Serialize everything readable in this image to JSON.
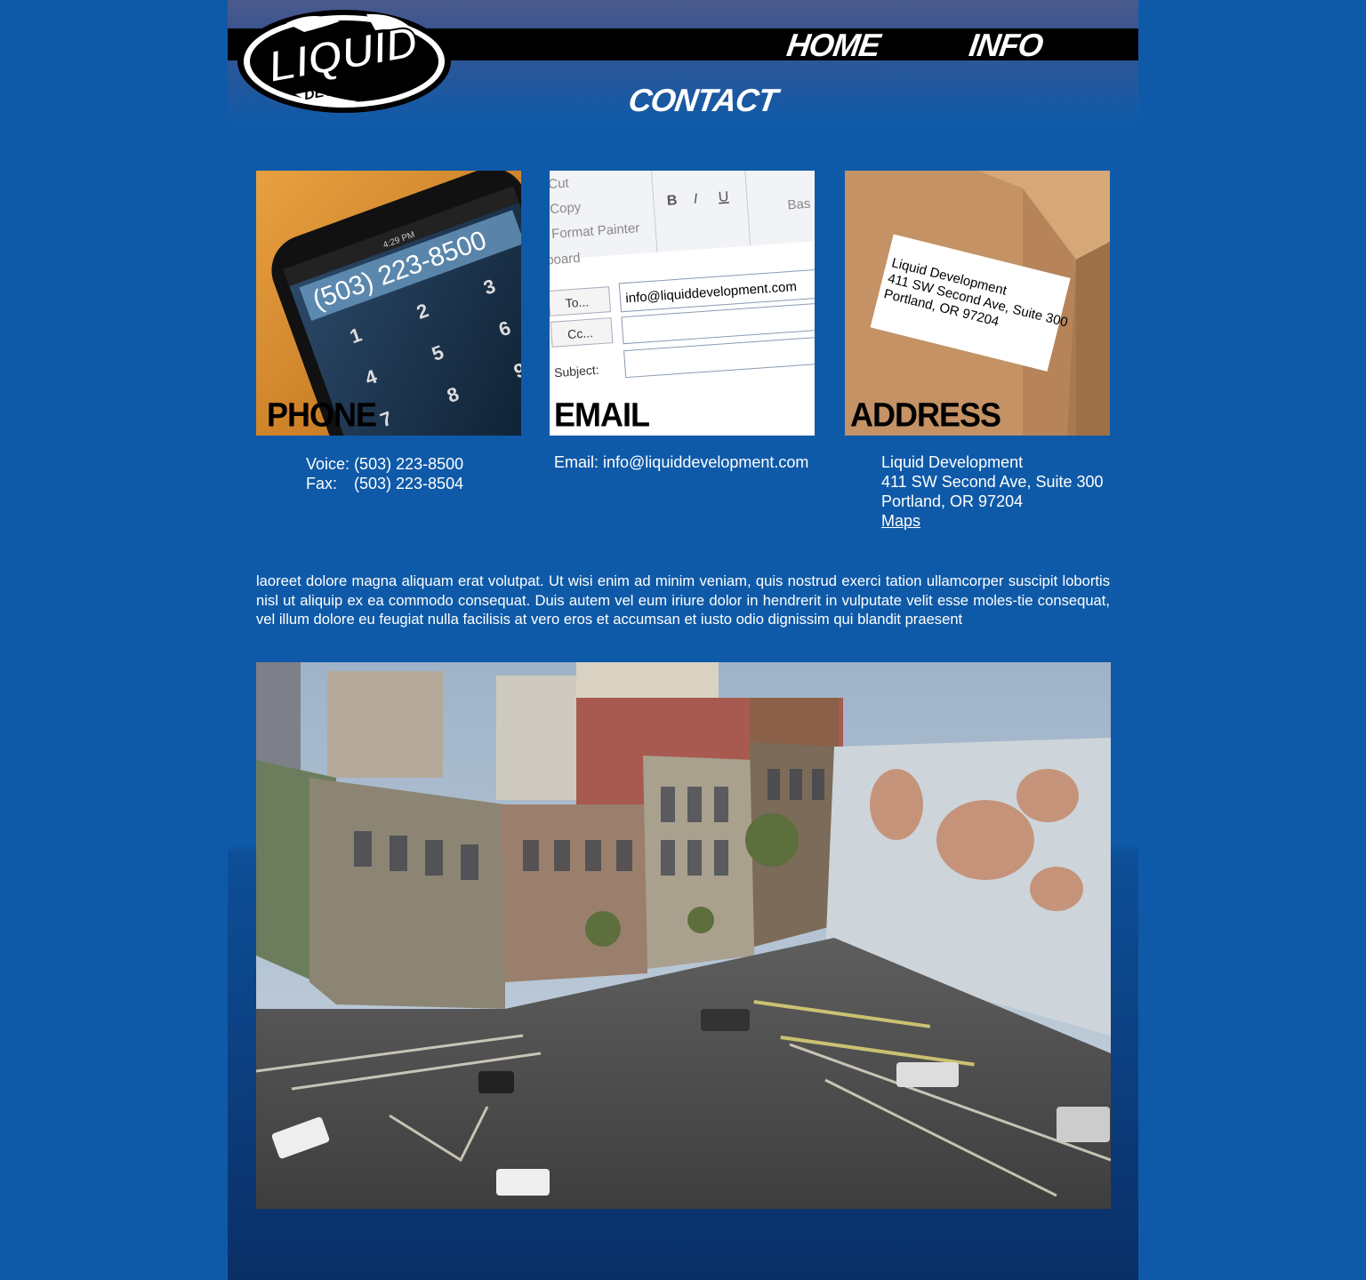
{
  "brand": {
    "logo_main": "LIQUID",
    "logo_sub": "DEVELOPMENT"
  },
  "nav": {
    "home": "HOME",
    "info": "INFO"
  },
  "page": {
    "title": "CONTACT"
  },
  "cards": {
    "phone": {
      "label": "PHONE",
      "screen_number": "(503) 223-8500",
      "screen_time": "4:29 PM"
    },
    "email": {
      "label": "EMAIL",
      "ribbon_cut": "Cut",
      "ribbon_copy": "Copy",
      "ribbon_format": "Format Painter",
      "ribbon_board": "board",
      "ribbon_bas": "Bas",
      "to_button": "To...",
      "cc_button": "Cc...",
      "subject_label": "Subject:",
      "to_value": "info@liquiddevelopment.com"
    },
    "address": {
      "label": "ADDRESS",
      "label_line1": "Liquid Development",
      "label_line2": "411 SW Second Ave, Suite 300",
      "label_line3": "Portland, OR 97204"
    }
  },
  "contact": {
    "voice_label": "Voice:",
    "voice_value": "(503) 223-8500",
    "fax_label": "Fax:",
    "fax_value": "(503) 223-8504",
    "email_line": "Email: info@liquiddevelopment.com",
    "addr_line1": "Liquid Development",
    "addr_line2": "411 SW Second Ave, Suite 300",
    "addr_line3": "Portland, OR 97204",
    "maps_link": "Maps"
  },
  "body_text": "laoreet dolore magna aliquam erat volutpat. Ut wisi enim ad minim veniam, quis nostrud exerci tation ullamcorper suscipit lobortis nisl ut aliquip ex ea commodo consequat. Duis autem vel eum iriure dolor in hendrerit in vulputate velit esse moles-tie consequat, vel illum dolore eu feugiat nulla facilisis at vero eros et accumsan et iusto odio dignissim qui blandit praesent",
  "colors": {
    "background": "#0f5aa8",
    "nav_bar": "#000000",
    "text": "#ffffff"
  }
}
